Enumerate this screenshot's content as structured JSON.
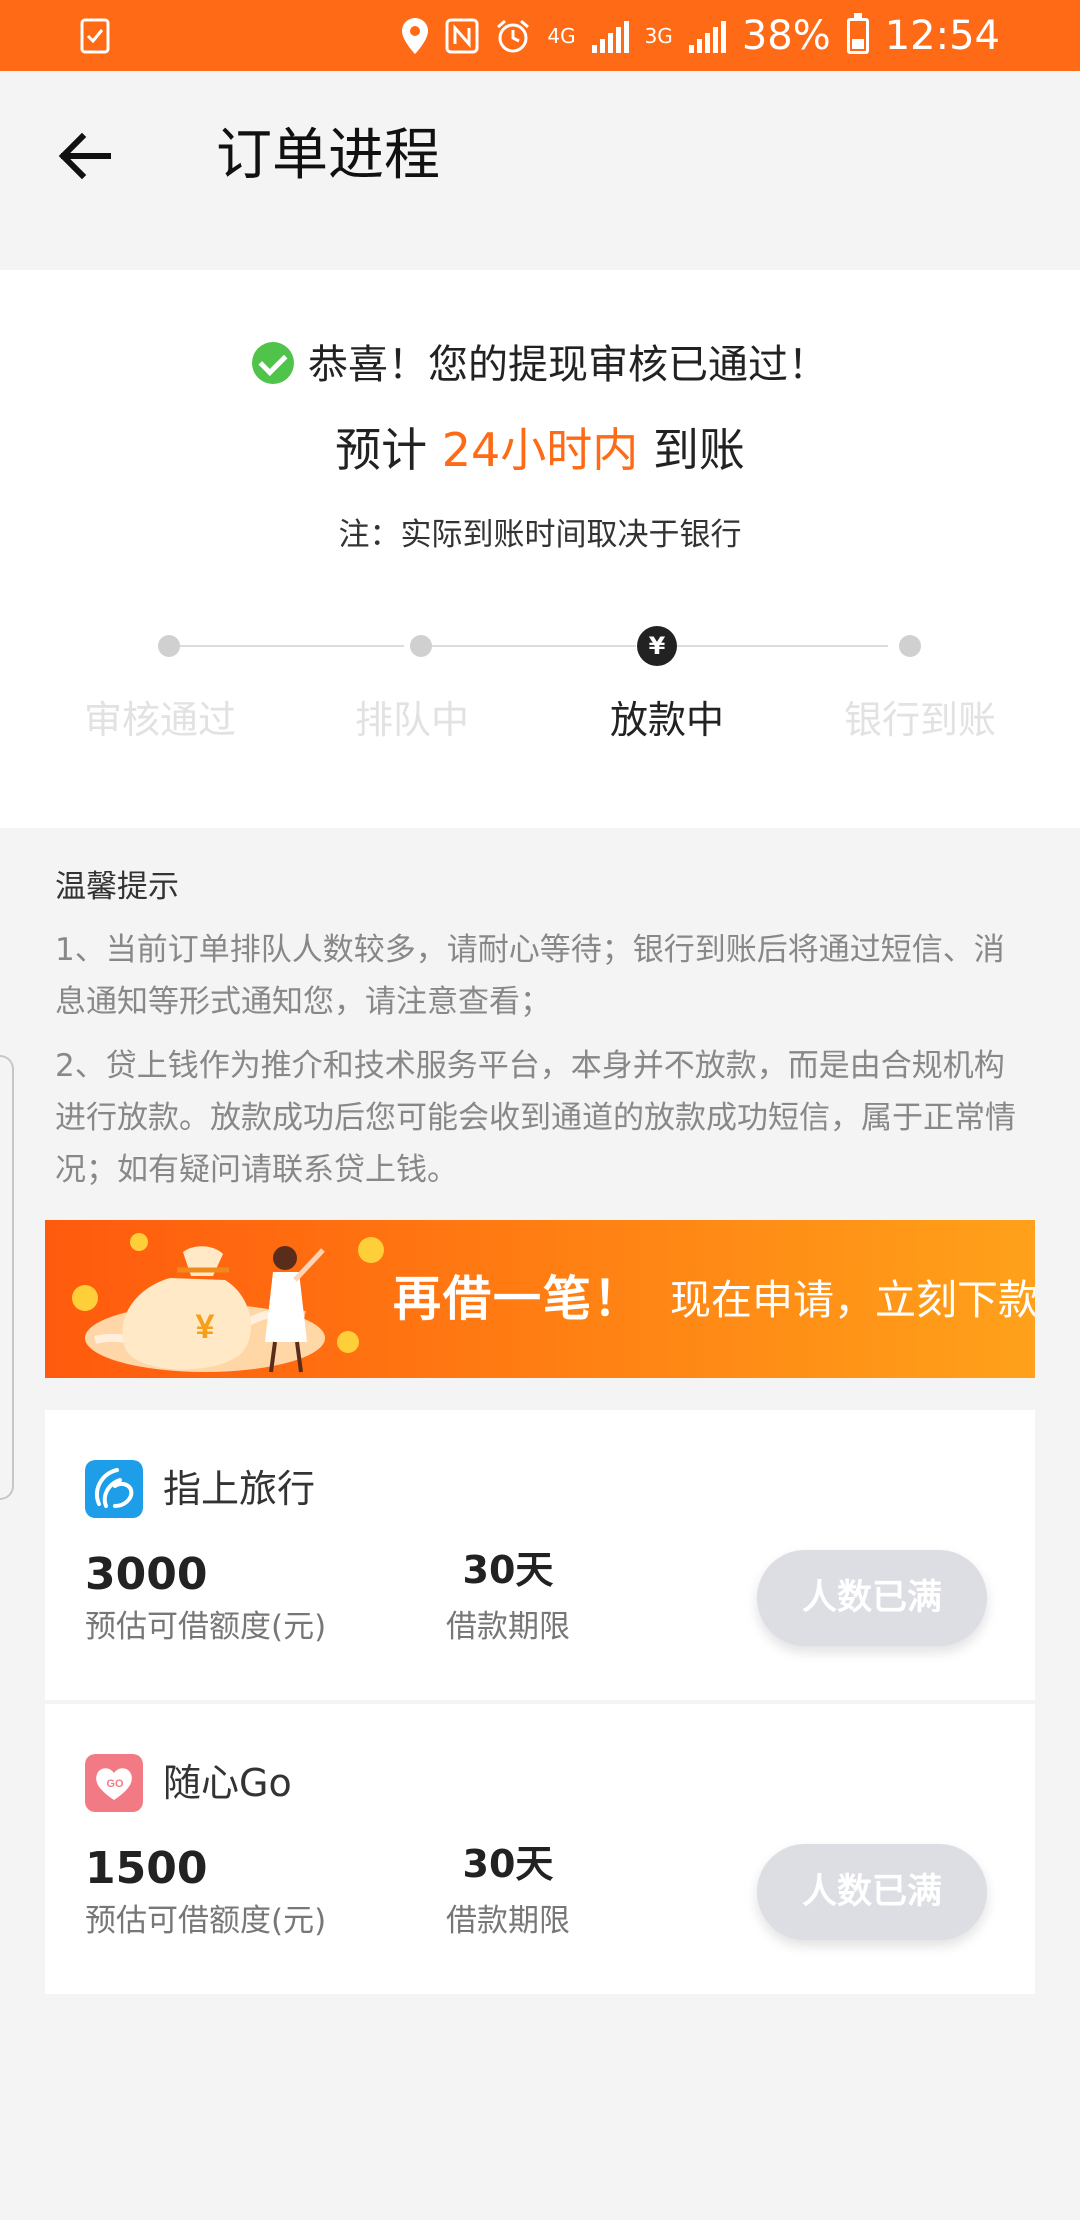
{
  "status_bar": {
    "network_labels": [
      "4G",
      "3G"
    ],
    "battery": "38%",
    "battery_level": 0.38,
    "time": "12:54",
    "icons": [
      "checklist-icon",
      "location-icon",
      "nfc-icon",
      "alarm-icon",
      "signal-icon",
      "battery-icon"
    ]
  },
  "header": {
    "title": "订单进程"
  },
  "status": {
    "success_text": "恭喜！您的提现审核已通过！",
    "eta_prefix": "预计 ",
    "eta_highlight": "24小时内",
    "eta_suffix": " 到账",
    "note": "注：实际到账时间取决于银行",
    "steps": [
      {
        "label": "审核通过",
        "active": false
      },
      {
        "label": "排队中",
        "active": false
      },
      {
        "label": "放款中",
        "active": true
      },
      {
        "label": "银行到账",
        "active": false
      }
    ],
    "active_step_symbol": "¥"
  },
  "tips": {
    "title": "温馨提示",
    "items": [
      "1、当前订单排队人数较多，请耐心等待；银行到账后将通过短信、消息通知等形式通知您，请注意查看；",
      "2、贷上钱作为推介和技术服务平台，本身并不放款，而是由合规机构进行放款。放款成功后您可能会收到通道的放款成功短信，属于正常情况；如有疑问请联系贷上钱。"
    ]
  },
  "banner": {
    "title": "再借一笔！",
    "subtitle": "现在申请，立刻下款",
    "art_symbol": "¥"
  },
  "loans": [
    {
      "name": "指上旅行",
      "icon": "zhishang-app-icon",
      "amount": "3000",
      "amount_label": "预估可借额度(元)",
      "term": "30天",
      "term_label": "借款期限",
      "button": "人数已满"
    },
    {
      "name": "随心Go",
      "icon": "suixin-app-icon",
      "icon_text": "GO",
      "amount": "1500",
      "amount_label": "预估可借额度(元)",
      "term": "30天",
      "term_label": "借款期限",
      "button": "人数已满"
    }
  ],
  "colors": {
    "accent": "#fe6a16",
    "success": "#4fc34a",
    "button_disabled": "#dcdee3"
  }
}
